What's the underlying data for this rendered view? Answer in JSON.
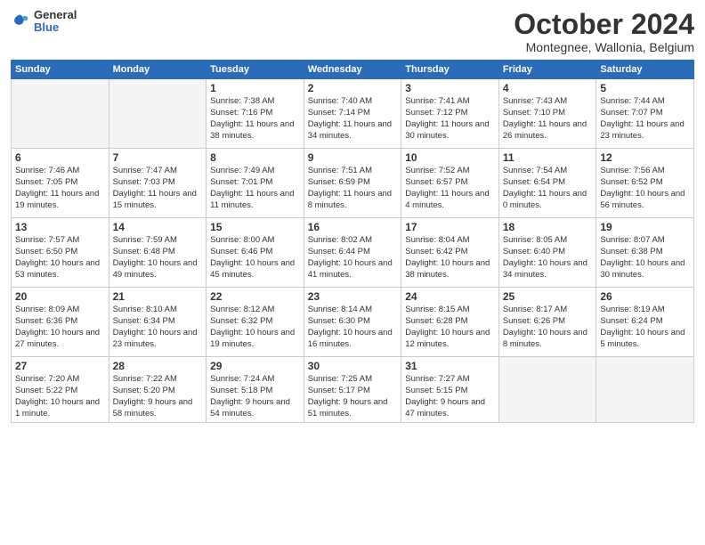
{
  "header": {
    "logo_general": "General",
    "logo_blue": "Blue",
    "title": "October 2024",
    "subtitle": "Montegnee, Wallonia, Belgium"
  },
  "days_of_week": [
    "Sunday",
    "Monday",
    "Tuesday",
    "Wednesday",
    "Thursday",
    "Friday",
    "Saturday"
  ],
  "weeks": [
    [
      {
        "day": "",
        "info": ""
      },
      {
        "day": "",
        "info": ""
      },
      {
        "day": "1",
        "info": "Sunrise: 7:38 AM\nSunset: 7:16 PM\nDaylight: 11 hours and 38 minutes."
      },
      {
        "day": "2",
        "info": "Sunrise: 7:40 AM\nSunset: 7:14 PM\nDaylight: 11 hours and 34 minutes."
      },
      {
        "day": "3",
        "info": "Sunrise: 7:41 AM\nSunset: 7:12 PM\nDaylight: 11 hours and 30 minutes."
      },
      {
        "day": "4",
        "info": "Sunrise: 7:43 AM\nSunset: 7:10 PM\nDaylight: 11 hours and 26 minutes."
      },
      {
        "day": "5",
        "info": "Sunrise: 7:44 AM\nSunset: 7:07 PM\nDaylight: 11 hours and 23 minutes."
      }
    ],
    [
      {
        "day": "6",
        "info": "Sunrise: 7:46 AM\nSunset: 7:05 PM\nDaylight: 11 hours and 19 minutes."
      },
      {
        "day": "7",
        "info": "Sunrise: 7:47 AM\nSunset: 7:03 PM\nDaylight: 11 hours and 15 minutes."
      },
      {
        "day": "8",
        "info": "Sunrise: 7:49 AM\nSunset: 7:01 PM\nDaylight: 11 hours and 11 minutes."
      },
      {
        "day": "9",
        "info": "Sunrise: 7:51 AM\nSunset: 6:59 PM\nDaylight: 11 hours and 8 minutes."
      },
      {
        "day": "10",
        "info": "Sunrise: 7:52 AM\nSunset: 6:57 PM\nDaylight: 11 hours and 4 minutes."
      },
      {
        "day": "11",
        "info": "Sunrise: 7:54 AM\nSunset: 6:54 PM\nDaylight: 11 hours and 0 minutes."
      },
      {
        "day": "12",
        "info": "Sunrise: 7:56 AM\nSunset: 6:52 PM\nDaylight: 10 hours and 56 minutes."
      }
    ],
    [
      {
        "day": "13",
        "info": "Sunrise: 7:57 AM\nSunset: 6:50 PM\nDaylight: 10 hours and 53 minutes."
      },
      {
        "day": "14",
        "info": "Sunrise: 7:59 AM\nSunset: 6:48 PM\nDaylight: 10 hours and 49 minutes."
      },
      {
        "day": "15",
        "info": "Sunrise: 8:00 AM\nSunset: 6:46 PM\nDaylight: 10 hours and 45 minutes."
      },
      {
        "day": "16",
        "info": "Sunrise: 8:02 AM\nSunset: 6:44 PM\nDaylight: 10 hours and 41 minutes."
      },
      {
        "day": "17",
        "info": "Sunrise: 8:04 AM\nSunset: 6:42 PM\nDaylight: 10 hours and 38 minutes."
      },
      {
        "day": "18",
        "info": "Sunrise: 8:05 AM\nSunset: 6:40 PM\nDaylight: 10 hours and 34 minutes."
      },
      {
        "day": "19",
        "info": "Sunrise: 8:07 AM\nSunset: 6:38 PM\nDaylight: 10 hours and 30 minutes."
      }
    ],
    [
      {
        "day": "20",
        "info": "Sunrise: 8:09 AM\nSunset: 6:36 PM\nDaylight: 10 hours and 27 minutes."
      },
      {
        "day": "21",
        "info": "Sunrise: 8:10 AM\nSunset: 6:34 PM\nDaylight: 10 hours and 23 minutes."
      },
      {
        "day": "22",
        "info": "Sunrise: 8:12 AM\nSunset: 6:32 PM\nDaylight: 10 hours and 19 minutes."
      },
      {
        "day": "23",
        "info": "Sunrise: 8:14 AM\nSunset: 6:30 PM\nDaylight: 10 hours and 16 minutes."
      },
      {
        "day": "24",
        "info": "Sunrise: 8:15 AM\nSunset: 6:28 PM\nDaylight: 10 hours and 12 minutes."
      },
      {
        "day": "25",
        "info": "Sunrise: 8:17 AM\nSunset: 6:26 PM\nDaylight: 10 hours and 8 minutes."
      },
      {
        "day": "26",
        "info": "Sunrise: 8:19 AM\nSunset: 6:24 PM\nDaylight: 10 hours and 5 minutes."
      }
    ],
    [
      {
        "day": "27",
        "info": "Sunrise: 7:20 AM\nSunset: 5:22 PM\nDaylight: 10 hours and 1 minute."
      },
      {
        "day": "28",
        "info": "Sunrise: 7:22 AM\nSunset: 5:20 PM\nDaylight: 9 hours and 58 minutes."
      },
      {
        "day": "29",
        "info": "Sunrise: 7:24 AM\nSunset: 5:18 PM\nDaylight: 9 hours and 54 minutes."
      },
      {
        "day": "30",
        "info": "Sunrise: 7:25 AM\nSunset: 5:17 PM\nDaylight: 9 hours and 51 minutes."
      },
      {
        "day": "31",
        "info": "Sunrise: 7:27 AM\nSunset: 5:15 PM\nDaylight: 9 hours and 47 minutes."
      },
      {
        "day": "",
        "info": ""
      },
      {
        "day": "",
        "info": ""
      }
    ]
  ]
}
